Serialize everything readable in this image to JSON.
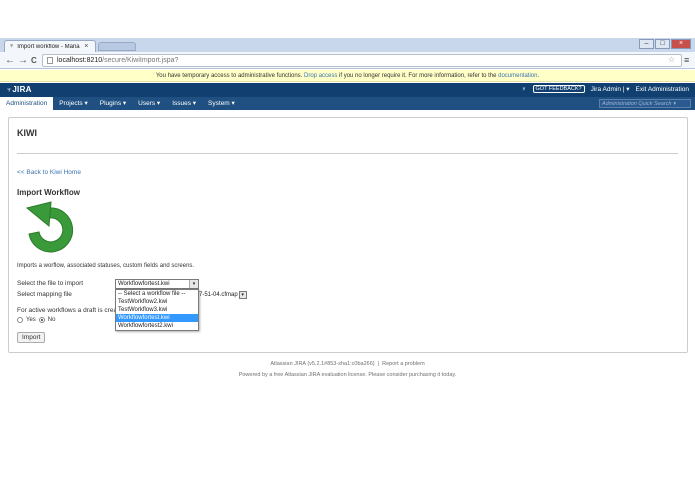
{
  "browser": {
    "tab_title": "Import workflow - Maria J",
    "tab_close": "×",
    "url_host": "localhost:8210",
    "url_path": "/secure/KiwiImport.jspa?",
    "back": "←",
    "forward": "→",
    "reload": "C",
    "star": "☆",
    "menu": "≡",
    "win_min": "–",
    "win_max": "□",
    "win_close": "×"
  },
  "banner": {
    "prefix": "You have temporary access to administrative functions.",
    "drop_link": "Drop access",
    "middle": "if you no longer require it. For more information, refer to the",
    "doc_link": "documentation",
    "suffix": "."
  },
  "header": {
    "logo": "JIRA",
    "feedback": "GOT FEEDBACK?",
    "user": "Jira Admin",
    "user_caret": "▾",
    "exit": "Exit Administration"
  },
  "nav": {
    "items": [
      {
        "label": "Administration"
      },
      {
        "label": "Projects ▾"
      },
      {
        "label": "Plugins ▾"
      },
      {
        "label": "Users ▾"
      },
      {
        "label": "Issues ▾"
      },
      {
        "label": "System ▾"
      }
    ],
    "quick_search_placeholder": "Administration Quick Search ▾"
  },
  "page": {
    "title": "KIWI",
    "back_link": "<< Back to Kiwi Home",
    "section_title": "Import Workflow",
    "description": "Imports a worflow, associated statuses, custom fields and screens.",
    "file_label": "Select the file to import",
    "file_value": "Workflowfortest.kwi",
    "mapping_label": "Select mapping file",
    "mapping_tail": "7-51-04.cfmap",
    "draft_label": "For active workflows a draft is creat",
    "radio_yes": "Yes",
    "radio_no": "No",
    "import_button": "Import",
    "dropdown_arrow": "▾",
    "options": [
      {
        "label": "-- Select a workflow file --",
        "selected": false
      },
      {
        "label": "TestWorkflow2.kwi",
        "selected": false
      },
      {
        "label": "TestWorkflow3.kwi",
        "selected": false
      },
      {
        "label": "Workflowfortest.kwi",
        "selected": true
      },
      {
        "label": "Workflowfortest2.kwi",
        "selected": false
      }
    ]
  },
  "footer": {
    "version": "Atlassian JIRA (v5.2.1#853-sha1:c0ba266)",
    "separator": "|",
    "report": "Report a problem",
    "license": "Powered by a free Atlassian JIRA evaluation license. Please consider purchasing it today."
  },
  "colors": {
    "header_bg": "#114070",
    "nav_bg": "#205081",
    "link": "#3b73af",
    "banner_bg": "#ffffc8",
    "icon_green": "#3a9a3a"
  }
}
